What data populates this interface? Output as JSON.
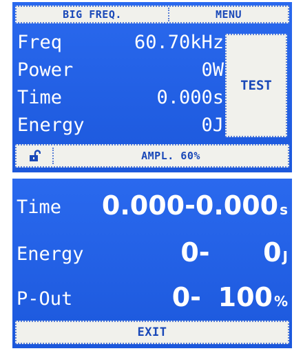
{
  "screen1": {
    "header": {
      "left_label": "BIG FREQ.",
      "right_label": "MENU"
    },
    "rows": [
      {
        "label": "Freq",
        "value": "60.70kHz"
      },
      {
        "label": "Power",
        "value": "0W"
      },
      {
        "label": "Time",
        "value": "0.000s"
      },
      {
        "label": "Energy",
        "value": "0J"
      }
    ],
    "test_label": "TEST",
    "footer": {
      "lock_icon": "unlock-icon",
      "ampl_label": "AMPL. 60%"
    }
  },
  "screen2": {
    "rows": [
      {
        "label": "Time",
        "from": "0.000",
        "to": "0.000",
        "unit": "s"
      },
      {
        "label": "Energy",
        "from": "0",
        "to": "0",
        "unit": "J"
      },
      {
        "label": "P-Out",
        "from": "0",
        "to": "100",
        "unit": "%"
      }
    ],
    "exit_label": "EXIT"
  },
  "colors": {
    "screen_bg": "#1f5fe2",
    "bar_bg": "#f1f1ec",
    "bar_text": "#1948b8",
    "text": "#ffffff"
  }
}
